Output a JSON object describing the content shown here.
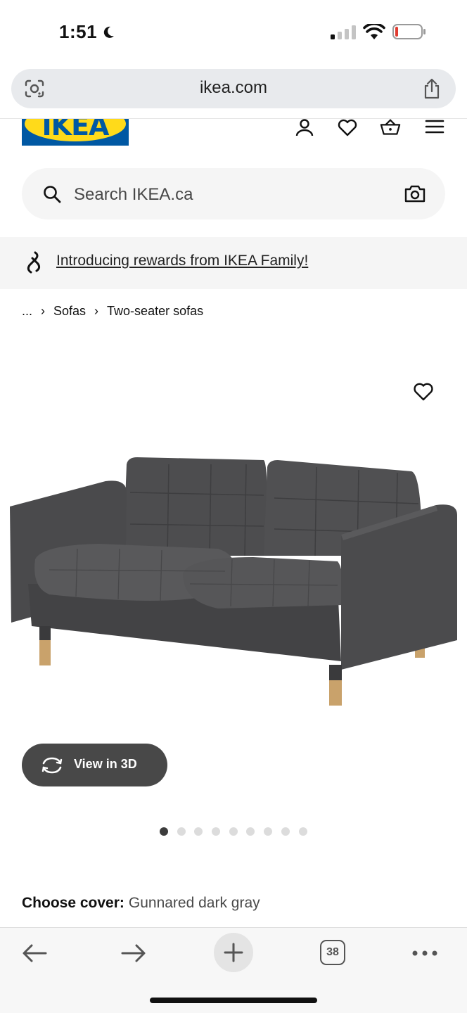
{
  "status_bar": {
    "time": "1:51",
    "icons": [
      "moon-icon",
      "signal-icon",
      "wifi-icon",
      "battery-icon"
    ]
  },
  "browser": {
    "url": "ikea.com",
    "icons": [
      "lens-icon",
      "share-icon"
    ]
  },
  "header": {
    "logo_text": "IKEA",
    "icons": [
      "account-icon",
      "wishlist-icon",
      "basket-icon",
      "menu-icon"
    ],
    "brand_colors": {
      "blue": "#0058a3",
      "yellow": "#ffda1a"
    }
  },
  "search": {
    "placeholder": "Search IKEA.ca",
    "icons": [
      "search-icon",
      "camera-icon"
    ]
  },
  "promo": {
    "text": "Introducing rewards from IKEA Family!",
    "icon": "family-link-icon"
  },
  "breadcrumb": {
    "items": [
      "...",
      "Sofas",
      "Two-seater sofas"
    ]
  },
  "product": {
    "favorite_icon": "heart-icon",
    "image_alt": "gray two-seater sofa with wooden legs",
    "view_3d_label": "View in 3D",
    "carousel": {
      "total": 9,
      "active_index": 0
    },
    "choose_cover_label": "Choose cover:",
    "cover_value": "Gunnared dark gray"
  },
  "toolbar": {
    "icons": [
      "back-arrow-icon",
      "forward-arrow-icon",
      "new-tab-icon",
      "tabs-icon",
      "more-icon"
    ],
    "tabs_count": "38"
  }
}
